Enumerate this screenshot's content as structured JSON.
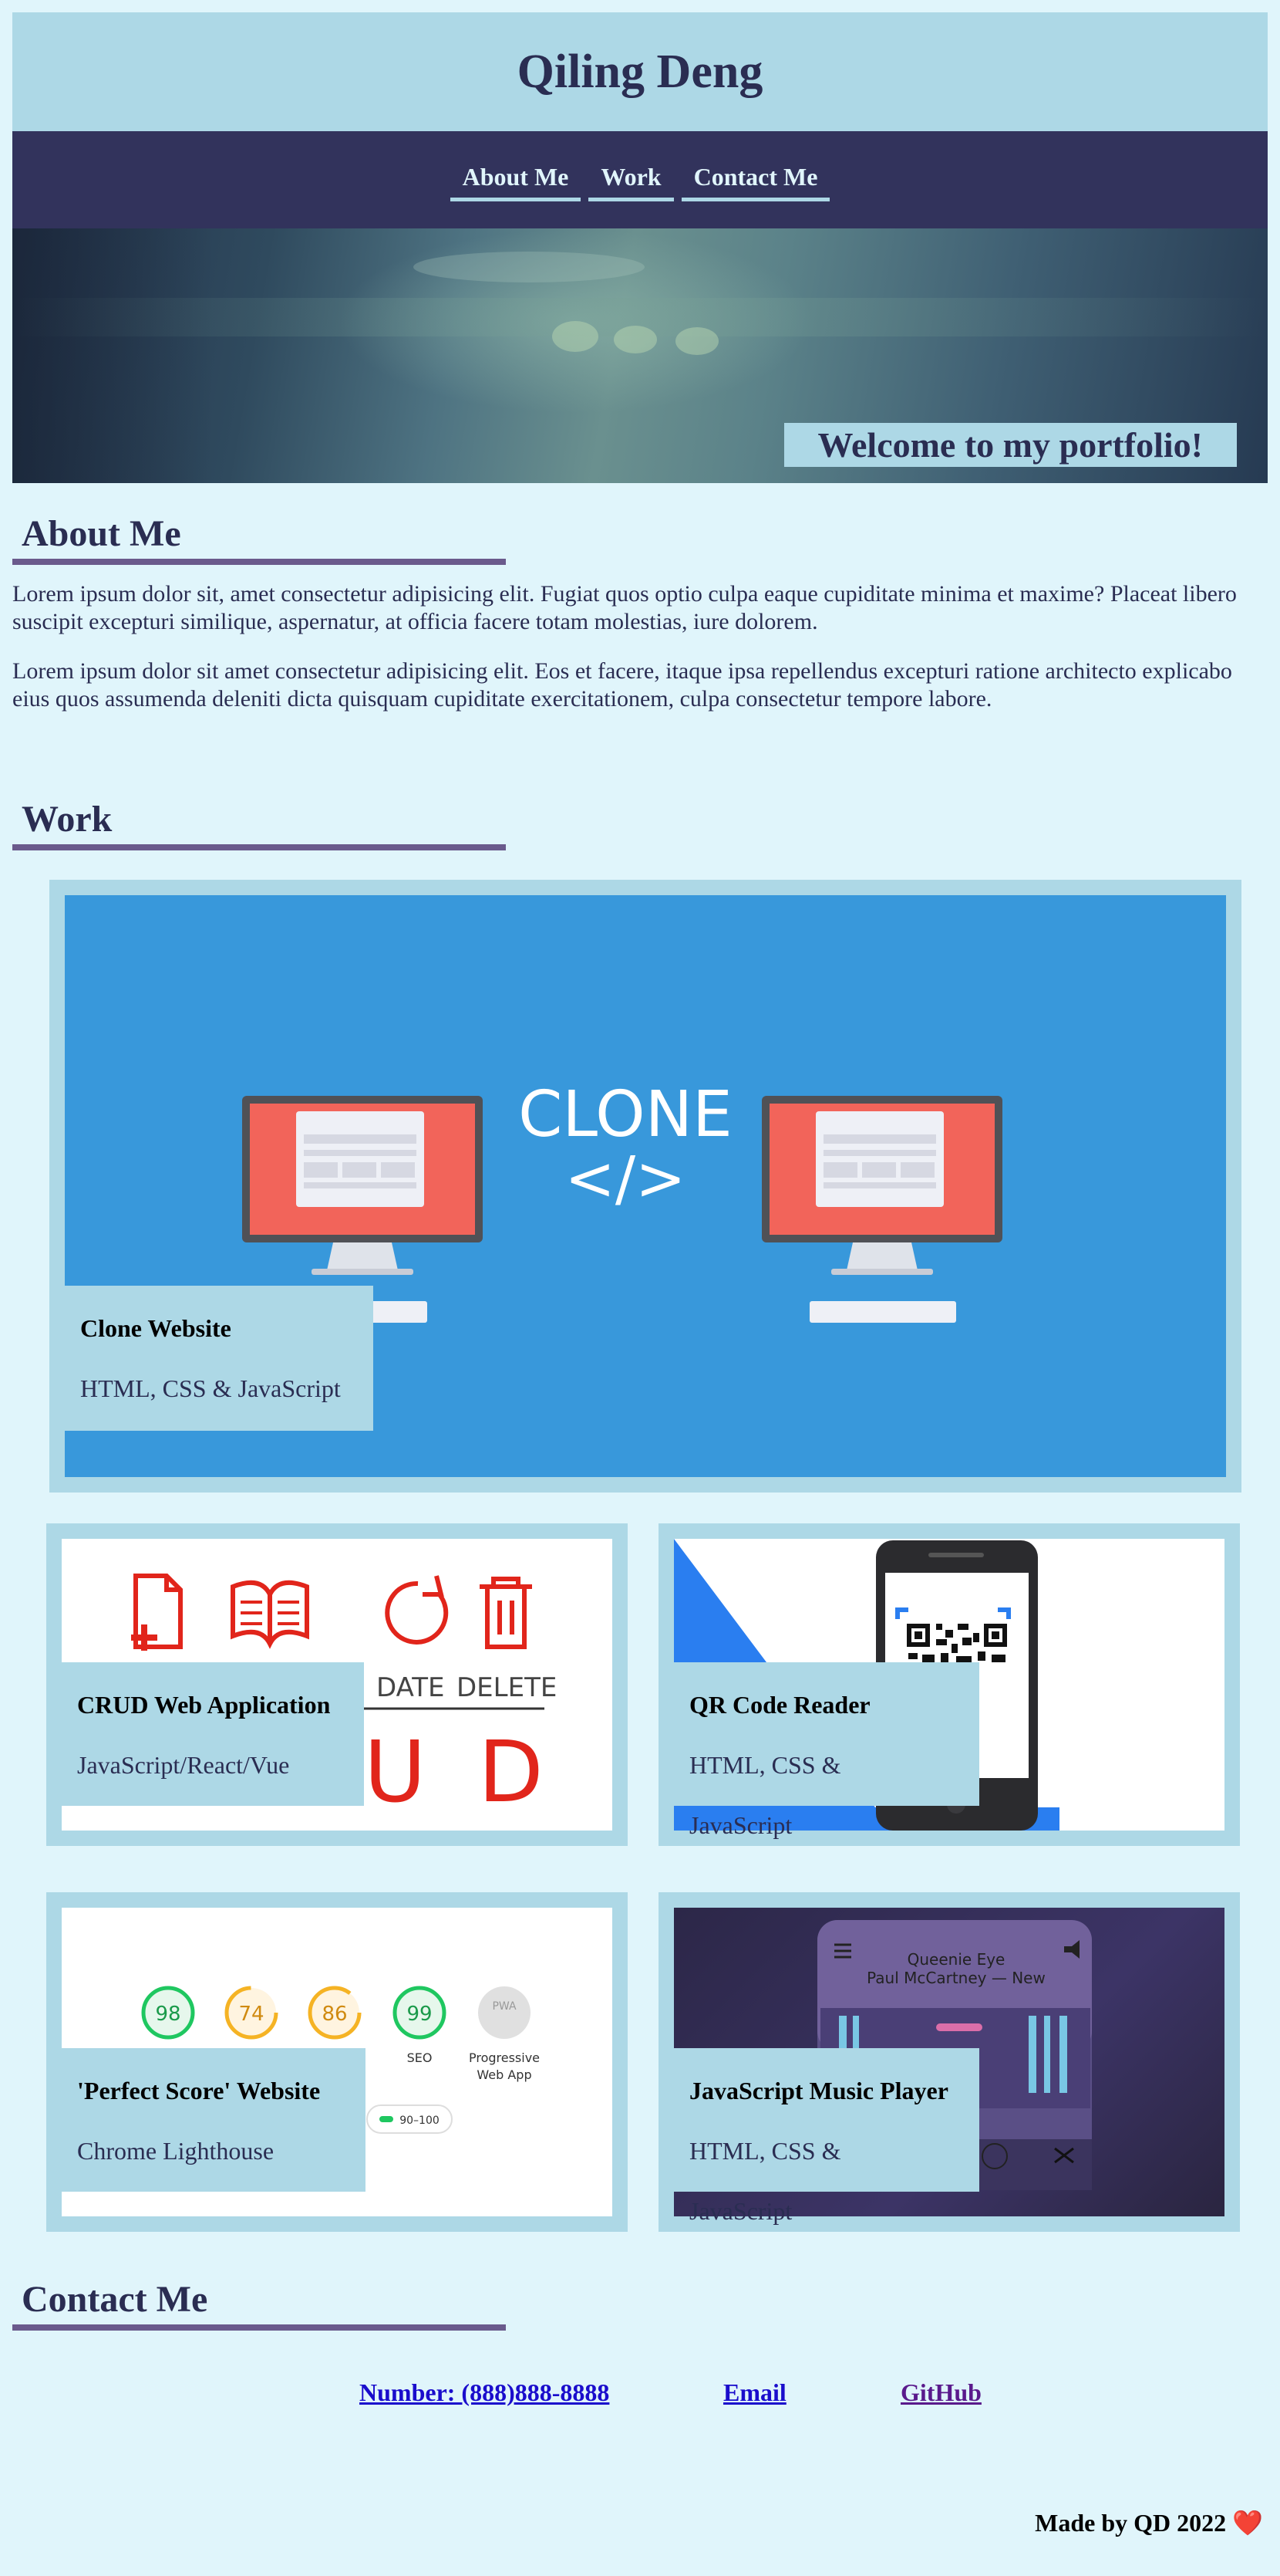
{
  "header": {
    "title": "Qiling Deng"
  },
  "nav": {
    "items": [
      {
        "label": "About Me"
      },
      {
        "label": "Work"
      },
      {
        "label": "Contact Me"
      }
    ]
  },
  "hero": {
    "banner": "Welcome to my portfolio!"
  },
  "about": {
    "heading": "About Me",
    "paragraphs": [
      "Lorem ipsum dolor sit, amet consectetur adipisicing elit. Fugiat quos optio culpa eaque cupiditate minima et maxime? Placeat libero suscipit excepturi similique, aspernatur, at officia facere totam molestias, iure dolorem.",
      "Lorem ipsum dolor sit amet consectetur adipisicing elit. Eos et facere, itaque ipsa repellendus excepturi ratione architecto explicabo eius quos assumenda deleniti dicta quisquam cupiditate exercitationem, culpa consectetur tempore labore."
    ]
  },
  "work": {
    "heading": "Work",
    "projects": [
      {
        "title": "Clone Website",
        "subtitle": "HTML, CSS & JavaScript",
        "image_text": [
          "CLONE",
          "</>"
        ]
      },
      {
        "title": "CRUD Web Application",
        "subtitle": "JavaScript/React/Vue",
        "image_text": [
          "DATE",
          "DELETE",
          "U",
          "D"
        ]
      },
      {
        "title": "QR Code Reader",
        "subtitle": "HTML, CSS & JavaScript"
      },
      {
        "title": "'Perfect Score' Website",
        "subtitle": "Chrome Lighthouse",
        "image_text": {
          "scores": [
            "98",
            "74",
            "86",
            "99"
          ],
          "pwa": "PWA",
          "seo": "SEO",
          "pwa_label_1": "Progressive",
          "pwa_label_2": "Web App",
          "legend": "90–100"
        }
      },
      {
        "title": "JavaScript Music Player",
        "subtitle": "HTML, CSS & JavaScript",
        "image_text": {
          "song": "Queenie Eye",
          "artist": "Paul McCartney — New"
        }
      }
    ]
  },
  "contact": {
    "heading": "Contact Me",
    "links": [
      {
        "label": "Number: (888)888-8888"
      },
      {
        "label": "Email"
      },
      {
        "label": "GitHub"
      }
    ]
  },
  "footer": {
    "text": "Made by QD 2022",
    "heart": "❤️"
  },
  "colors": {
    "background": "#e0f5fb",
    "accent": "#add8e6",
    "nav": "#32335c",
    "heading": "#2a2d52",
    "underline": "#6a5a8c"
  }
}
